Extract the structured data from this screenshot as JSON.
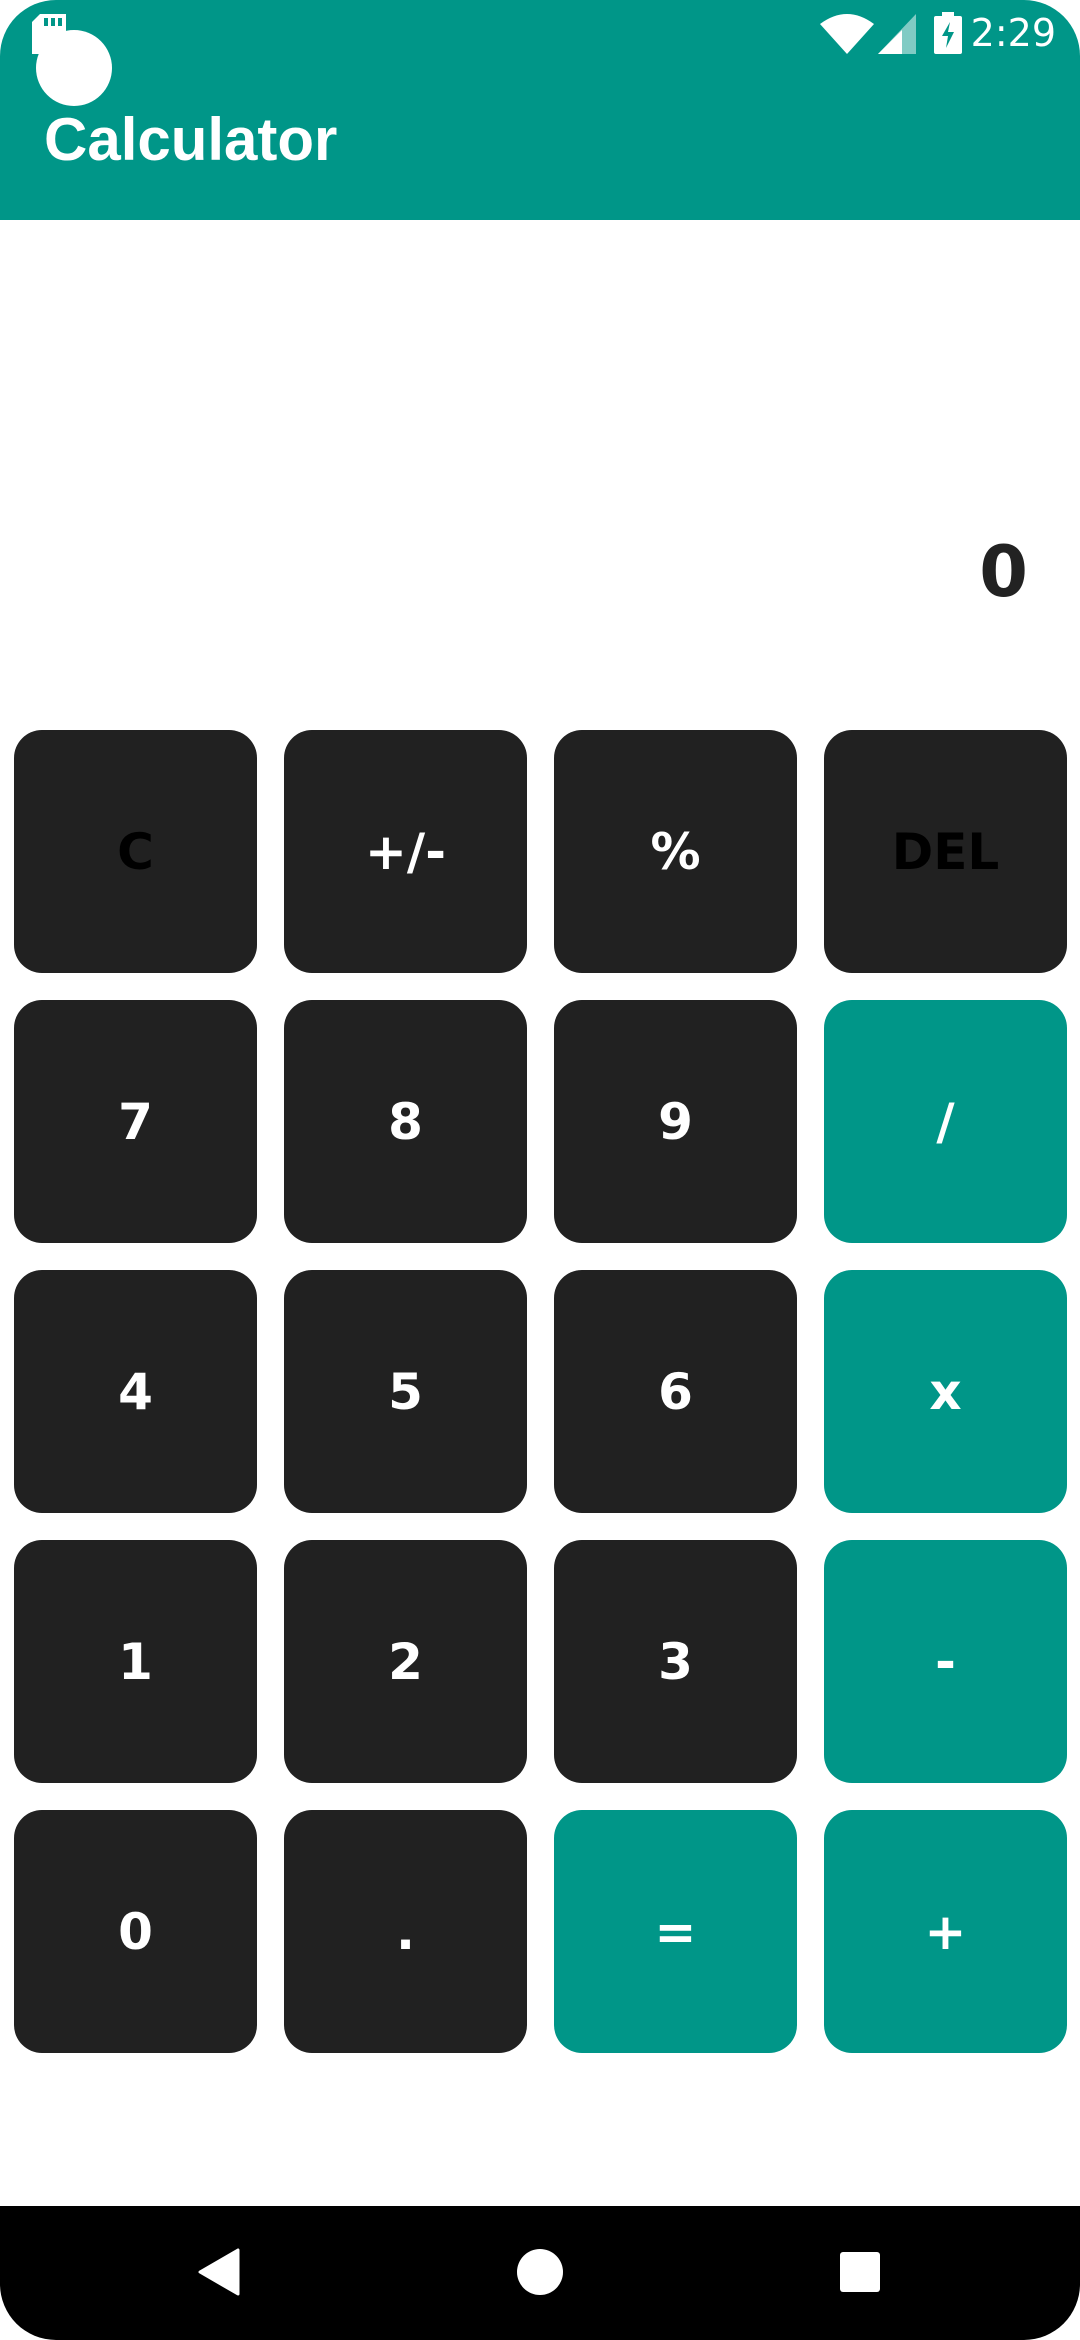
{
  "status_bar": {
    "time": "2:29",
    "icons": [
      "sd-card-icon",
      "wifi-icon",
      "cell-signal-icon",
      "battery-charging-icon"
    ]
  },
  "app_bar": {
    "title": "Calculator",
    "color": "#009688"
  },
  "display": {
    "value": "0"
  },
  "keypad": {
    "rows": [
      [
        {
          "label": "C",
          "style": "dark-text"
        },
        {
          "label": "+/-",
          "style": "dark"
        },
        {
          "label": "%",
          "style": "dark"
        },
        {
          "label": "DEL",
          "style": "dark-text"
        }
      ],
      [
        {
          "label": "7",
          "style": "dark"
        },
        {
          "label": "8",
          "style": "dark"
        },
        {
          "label": "9",
          "style": "dark"
        },
        {
          "label": "/",
          "style": "accent"
        }
      ],
      [
        {
          "label": "4",
          "style": "dark"
        },
        {
          "label": "5",
          "style": "dark"
        },
        {
          "label": "6",
          "style": "dark"
        },
        {
          "label": "x",
          "style": "accent"
        }
      ],
      [
        {
          "label": "1",
          "style": "dark"
        },
        {
          "label": "2",
          "style": "dark"
        },
        {
          "label": "3",
          "style": "dark"
        },
        {
          "label": "-",
          "style": "accent"
        }
      ],
      [
        {
          "label": "0",
          "style": "dark"
        },
        {
          "label": ".",
          "style": "dark"
        },
        {
          "label": "=",
          "style": "accent"
        },
        {
          "label": "+",
          "style": "accent"
        }
      ]
    ],
    "colors": {
      "key_background": "#212121",
      "accent": "#009688",
      "key_text": "#ffffff"
    }
  },
  "nav_bar": {
    "buttons": [
      "back-icon",
      "home-icon",
      "recents-icon"
    ]
  }
}
